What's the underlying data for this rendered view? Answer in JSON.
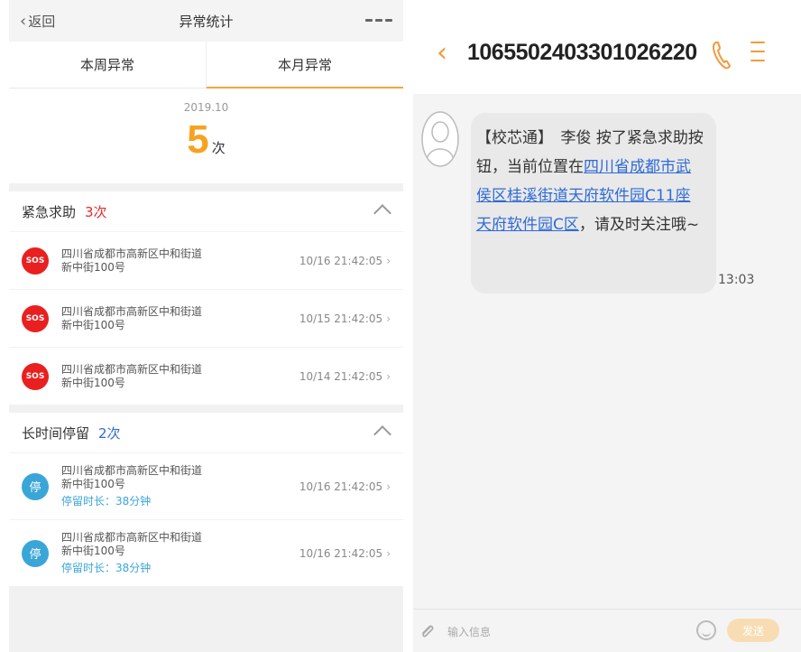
{
  "left": {
    "nav": {
      "back_label": "返回",
      "title": "异常统计"
    },
    "tabs": [
      {
        "label": "本周异常"
      },
      {
        "label": "本月异常",
        "active": true
      }
    ],
    "summary": {
      "month": "2019.10",
      "count": "5",
      "unit": "次"
    },
    "sections": {
      "sos": {
        "title": "紧急求助",
        "count": "3次",
        "badge": "SOS",
        "items": [
          {
            "addr1": "四川省成都市高新区中和街道",
            "addr2": "新中街100号",
            "time": "10/16 21:42:05"
          },
          {
            "addr1": "四川省成都市高新区中和街道",
            "addr2": "新中街100号",
            "time": "10/15 21:42:05"
          },
          {
            "addr1": "四川省成都市高新区中和街道",
            "addr2": "新中街100号",
            "time": "10/14 21:42:05"
          }
        ]
      },
      "stay": {
        "title": "长时间停留",
        "count": "2次",
        "badge": "停",
        "items": [
          {
            "addr1": "四川省成都市高新区中和街道",
            "addr2": "新中街100号",
            "duration": "停留时长：38分钟",
            "time": "10/16 21:42:05"
          },
          {
            "addr1": "四川省成都市高新区中和街道",
            "addr2": "新中街100号",
            "duration": "停留时长：38分钟",
            "time": "10/16 21:42:05"
          }
        ]
      }
    }
  },
  "right": {
    "sender": "1065502403301026220",
    "message": {
      "prefix": "【校芯通】　李俊  按了紧急求助按钮，当前位置在",
      "link": "四川省成都市武侯区桂溪街道天府软件园C11座天府软件园C区",
      "suffix": "，请及时关注哦~",
      "time": "13:03"
    },
    "input_placeholder": "输入信息",
    "send_label": "发送"
  },
  "colors": {
    "accent": "#f39a3c",
    "sos_red": "#ea1f1f",
    "stay_blue": "#3aa6d8",
    "link_blue": "#2f6bd6"
  }
}
